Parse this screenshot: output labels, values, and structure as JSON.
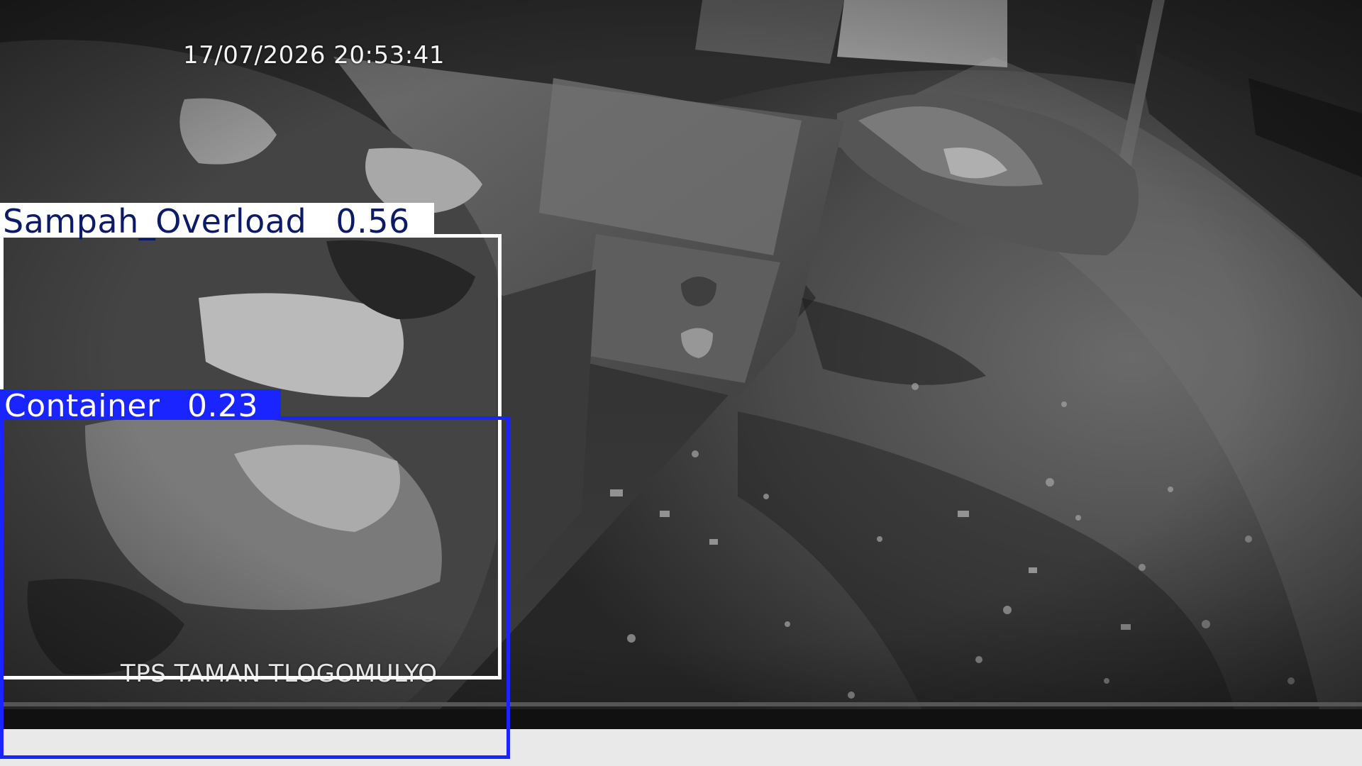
{
  "camera_feed": {
    "timestamp": "17/07/2026 20:53:41",
    "location_label": "TPS TAMAN TLOGOMULYO"
  },
  "detections": [
    {
      "id": "overload",
      "class_label": "Sampah_Overload",
      "confidence": "0.56",
      "box_color": "#ffffff",
      "label_text_color": "#0d1a66"
    },
    {
      "id": "container",
      "class_label": "Container",
      "confidence": "0.23",
      "box_color": "#1a24ff",
      "label_text_color": "#ffffff"
    }
  ],
  "colors": {
    "page_background": "#e9e9e9",
    "feed_dark_bar": "#111111"
  }
}
